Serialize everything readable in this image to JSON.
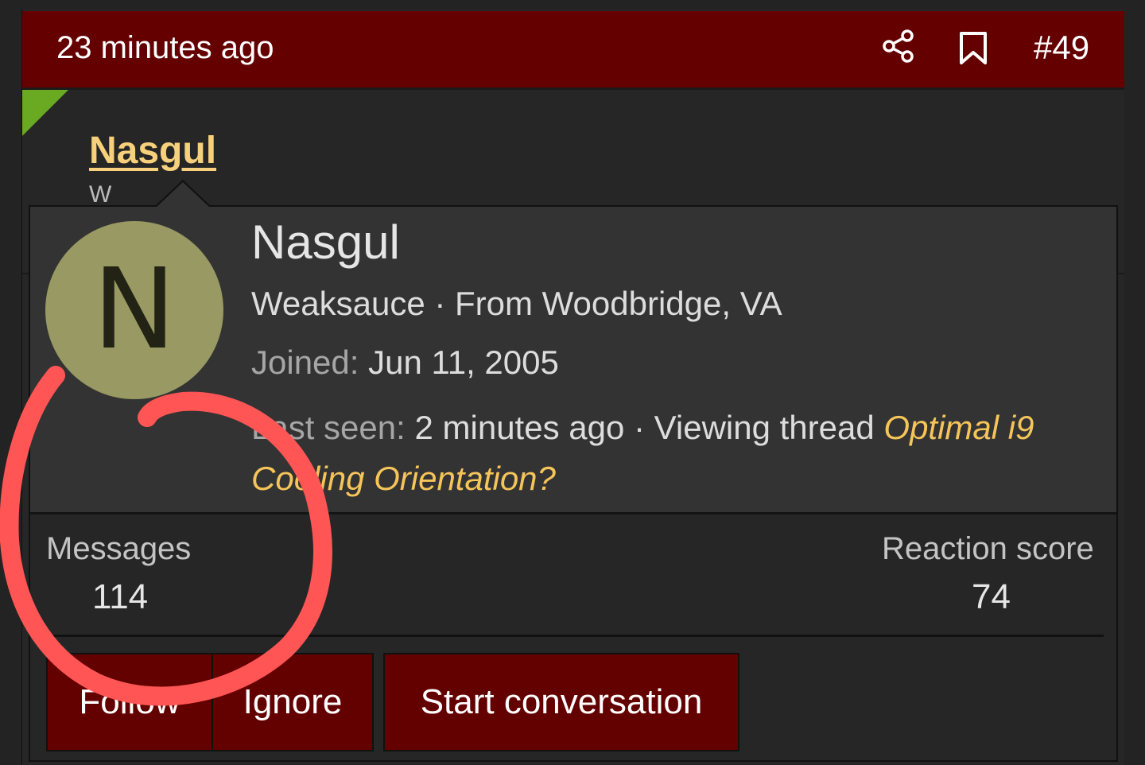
{
  "post": {
    "time_ago": "23 minutes ago",
    "post_number": "#49",
    "author": "Nasgul",
    "author_title_peek": "W",
    "share_icon": "share-icon",
    "bookmark_icon": "bookmark-icon"
  },
  "tooltip": {
    "avatar_letter": "N",
    "avatar_color": "#999963",
    "name": "Nasgul",
    "blurb": "Weaksauce · From Woodbridge, VA",
    "joined_label": "Joined:",
    "joined_value": "Jun 11, 2005",
    "last_seen_label": "Last seen:",
    "last_seen_value": "2 minutes ago · Viewing thread",
    "thread_title": "Optimal i9 Cooling Orientation?",
    "stats": {
      "messages_label": "Messages",
      "messages_value": "114",
      "reaction_label": "Reaction score",
      "reaction_value": "74"
    },
    "buttons": {
      "follow": "Follow",
      "ignore": "Ignore",
      "start_conversation": "Start conversation"
    }
  },
  "colors": {
    "header_bg": "#640000",
    "accent_link": "#f6d07a",
    "unread_marker": "#6aaa22",
    "annotation": "#ff5555"
  }
}
